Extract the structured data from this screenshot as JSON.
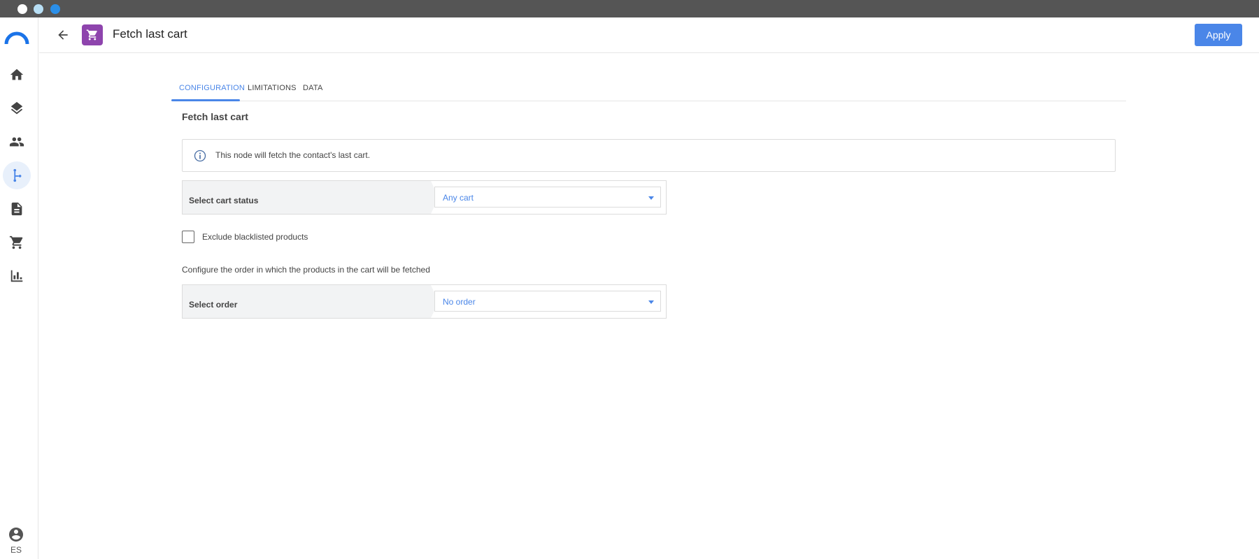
{
  "window": {
    "dots": [
      "close",
      "minimize",
      "maximize"
    ]
  },
  "sidebar": {
    "items": [
      {
        "name": "home",
        "icon": "home-icon"
      },
      {
        "name": "layers",
        "icon": "layers-icon"
      },
      {
        "name": "contacts",
        "icon": "people-icon"
      },
      {
        "name": "workflows",
        "icon": "flow-icon",
        "active": true
      },
      {
        "name": "documents",
        "icon": "document-icon"
      },
      {
        "name": "cart",
        "icon": "cart-icon"
      },
      {
        "name": "reports",
        "icon": "bar-chart-icon"
      }
    ],
    "language": "ES"
  },
  "header": {
    "title": "Fetch last cart",
    "node_icon": "cart-icon",
    "apply_label": "Apply"
  },
  "tabs": [
    {
      "label": "CONFIGURATION",
      "active": true
    },
    {
      "label": "LIMITATIONS",
      "active": false
    },
    {
      "label": "DATA",
      "active": false
    }
  ],
  "section": {
    "title": "Fetch last cart",
    "info_text": "This node will fetch the contact's last cart."
  },
  "cart_status": {
    "label": "Select cart status",
    "value": "Any cart"
  },
  "exclude_blacklisted": {
    "label": "Exclude blacklisted products",
    "checked": false
  },
  "order": {
    "help_text": "Configure the order in which the products in the cart will be fetched",
    "label": "Select order",
    "value": "No order"
  },
  "colors": {
    "accent": "#4a86e8",
    "node_icon_bg": "#8e44ad",
    "chrome": "#555555"
  }
}
